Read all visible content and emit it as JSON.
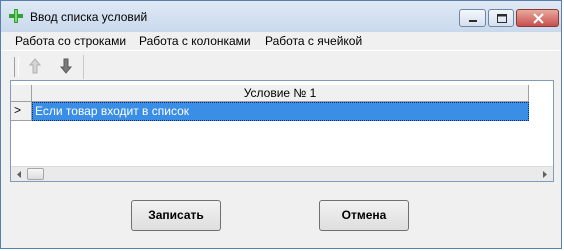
{
  "window": {
    "title": "Ввод списка условий",
    "icon": "green-cross-icon",
    "controls": [
      "minimize-icon",
      "maximize-icon",
      "close-icon"
    ]
  },
  "menu": {
    "items": [
      "Работа со строками",
      "Работа с колонками",
      "Работа с ячейкой"
    ]
  },
  "toolbar": {
    "buttons": [
      {
        "icon": "move-up-arrow-icon",
        "enabled": false
      },
      {
        "icon": "move-down-arrow-icon",
        "enabled": true
      }
    ]
  },
  "grid": {
    "columns": [
      "Условие № 1"
    ],
    "rows": [
      {
        "indicator": ">",
        "cells": [
          "Если товар входит в список"
        ],
        "selected": true
      }
    ]
  },
  "buttons": {
    "save": "Записать",
    "cancel": "Отмена"
  },
  "colors": {
    "selection": "#3a8ee6",
    "close_button": "#c75050"
  }
}
